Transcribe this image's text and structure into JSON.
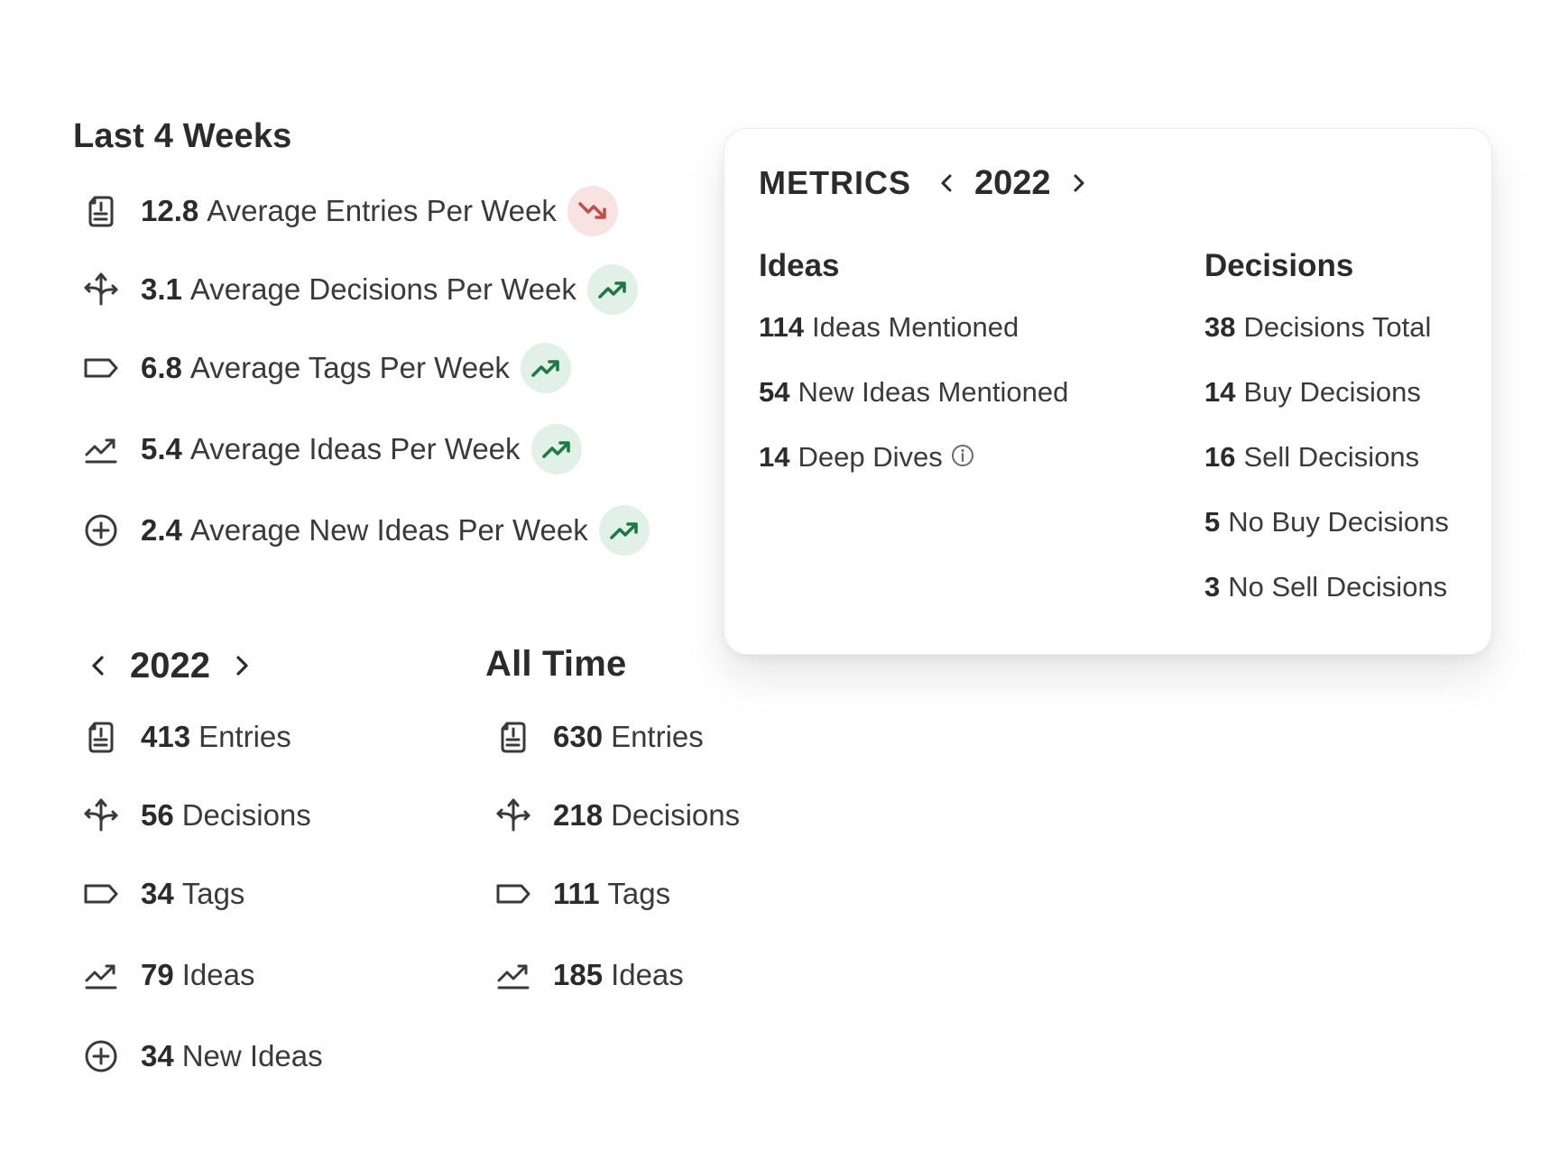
{
  "last4": {
    "title": "Last 4 Weeks",
    "items": [
      {
        "icon": "document-icon",
        "value": "12.8",
        "label": "Average Entries Per Week",
        "trend": "down"
      },
      {
        "icon": "split-arrows-icon",
        "value": "3.1",
        "label": "Average Decisions Per Week",
        "trend": "up"
      },
      {
        "icon": "tag-icon",
        "value": "6.8",
        "label": "Average Tags Per Week",
        "trend": "up"
      },
      {
        "icon": "trending-line-icon",
        "value": "5.4",
        "label": "Average Ideas Per Week",
        "trend": "up"
      },
      {
        "icon": "plus-circle-icon",
        "value": "2.4",
        "label": "Average New Ideas Per Week",
        "trend": "up"
      }
    ]
  },
  "year_section": {
    "year": "2022",
    "items": [
      {
        "icon": "document-icon",
        "value": "413",
        "label": "Entries"
      },
      {
        "icon": "split-arrows-icon",
        "value": "56",
        "label": "Decisions"
      },
      {
        "icon": "tag-icon",
        "value": "34",
        "label": "Tags"
      },
      {
        "icon": "trending-line-icon",
        "value": "79",
        "label": "Ideas"
      },
      {
        "icon": "plus-circle-icon",
        "value": "34",
        "label": "New Ideas"
      }
    ]
  },
  "all_time": {
    "title": "All Time",
    "items": [
      {
        "icon": "document-icon",
        "value": "630",
        "label": "Entries"
      },
      {
        "icon": "split-arrows-icon",
        "value": "218",
        "label": "Decisions"
      },
      {
        "icon": "tag-icon",
        "value": "111",
        "label": "Tags"
      },
      {
        "icon": "trending-line-icon",
        "value": "185",
        "label": "Ideas"
      }
    ]
  },
  "metrics_card": {
    "label": "METRICS",
    "year": "2022",
    "ideas": {
      "title": "Ideas",
      "items": [
        {
          "value": "114",
          "label": "Ideas Mentioned"
        },
        {
          "value": "54",
          "label": "New Ideas Mentioned"
        },
        {
          "value": "14",
          "label": "Deep Dives",
          "info": true
        }
      ]
    },
    "decisions": {
      "title": "Decisions",
      "items": [
        {
          "value": "38",
          "label": "Decisions Total"
        },
        {
          "value": "14",
          "label": "Buy Decisions"
        },
        {
          "value": "16",
          "label": "Sell Decisions"
        },
        {
          "value": "5",
          "label": "No Buy Decisions"
        },
        {
          "value": "3",
          "label": "No Sell Decisions"
        }
      ]
    }
  },
  "colors": {
    "trend_up": "#1e7a45",
    "trend_up_bg": "#e2f1e8",
    "trend_down": "#c0504d",
    "trend_down_bg": "#f8e3e3",
    "text": "#2b2b2b"
  }
}
